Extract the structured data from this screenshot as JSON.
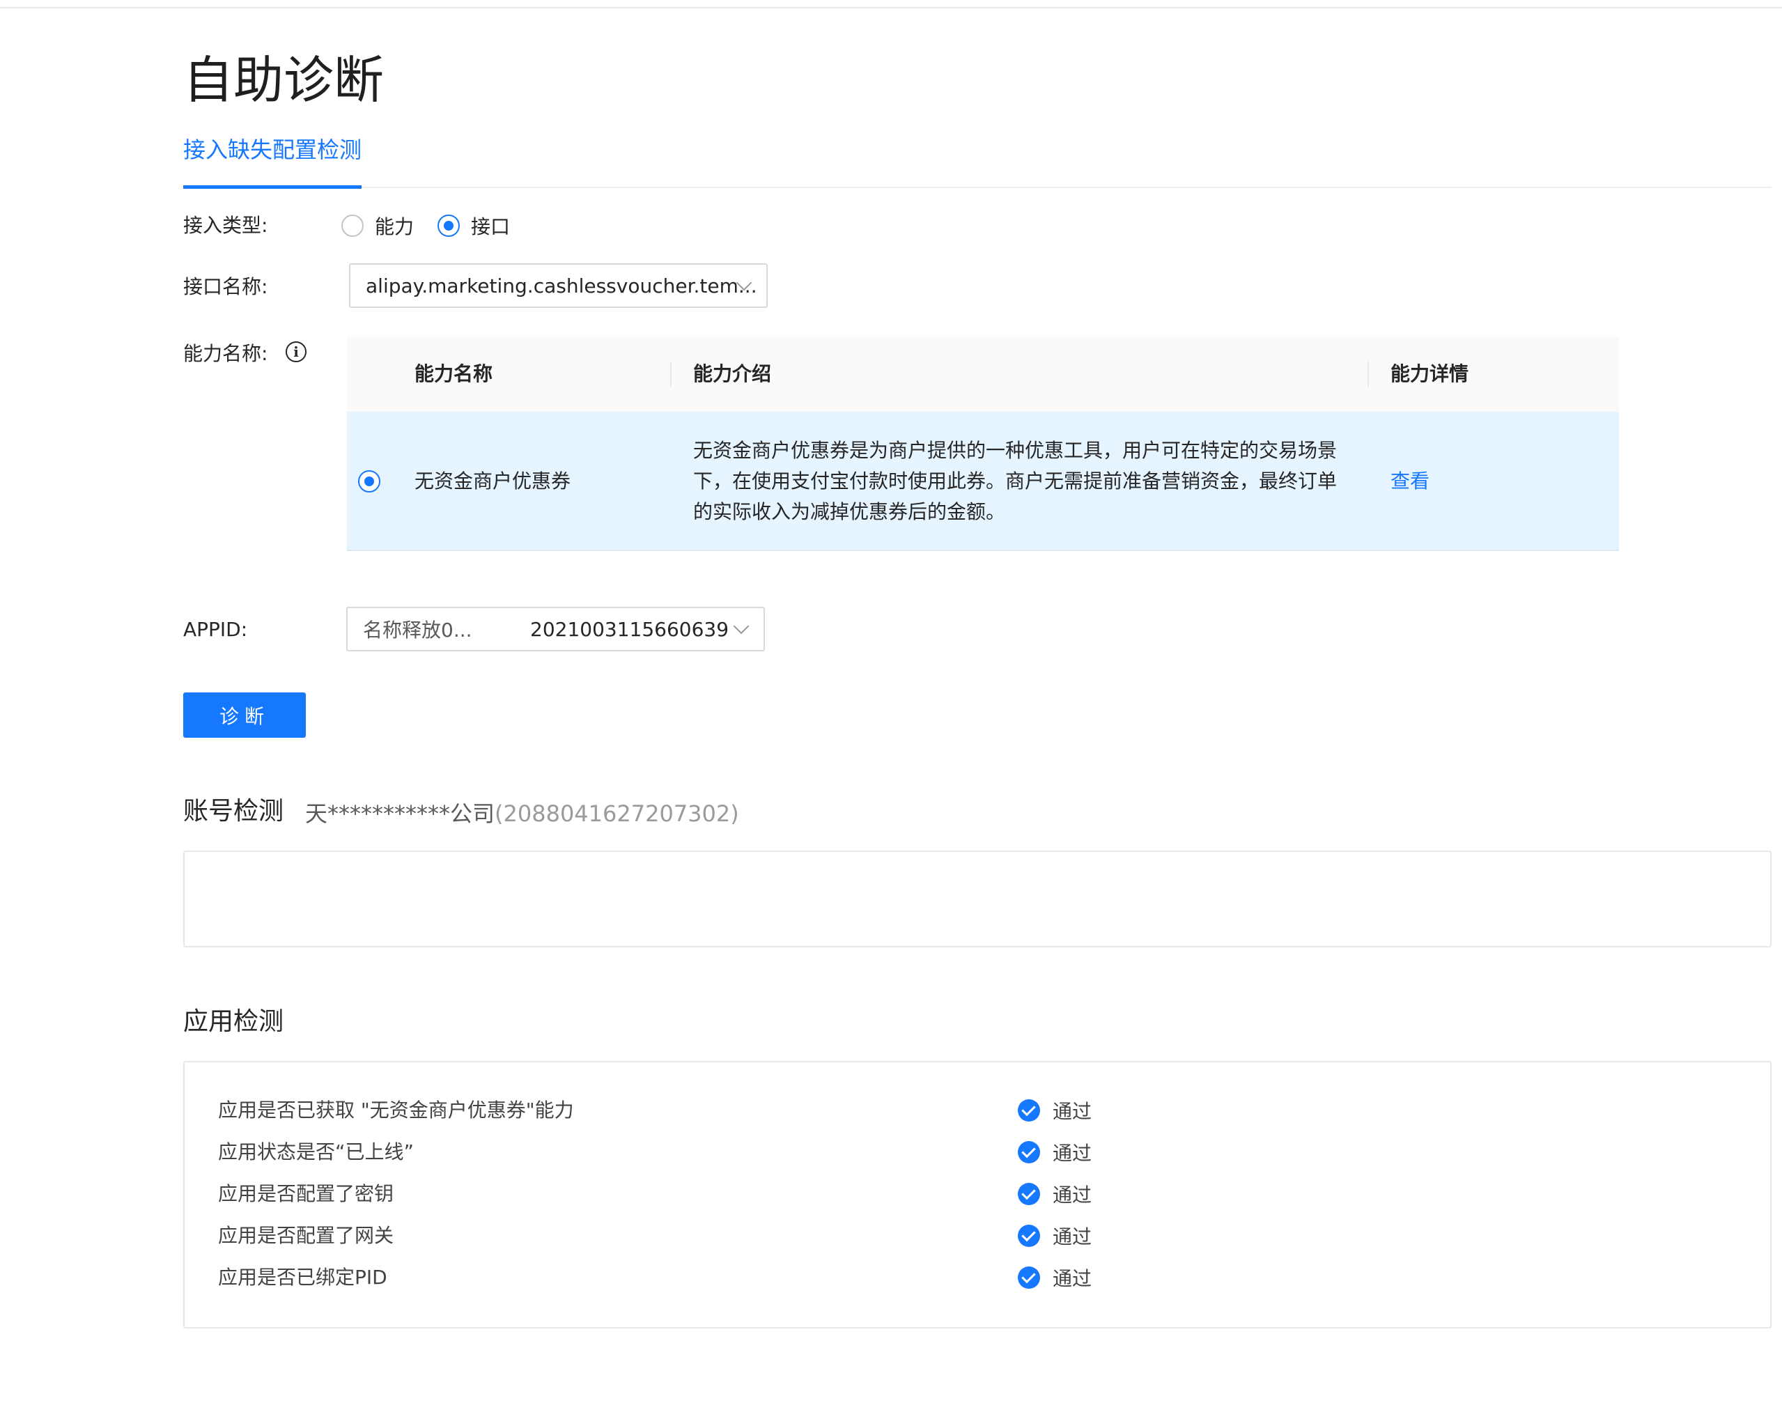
{
  "page": {
    "title": "自助诊断"
  },
  "tabs": [
    {
      "label": "接入缺失配置检测",
      "active": true
    }
  ],
  "form": {
    "access_type": {
      "label": "接入类型:",
      "options": [
        {
          "label": "能力",
          "checked": false
        },
        {
          "label": "接口",
          "checked": true
        }
      ]
    },
    "api_name": {
      "label": "接口名称:",
      "value": "alipay.marketing.cashlessvoucher.tem..."
    },
    "ability_name": {
      "label": "能力名称:",
      "info_icon": "info-icon"
    },
    "appid": {
      "label": "APPID:",
      "name": "名称释放0...",
      "id": "2021003115660639"
    }
  },
  "ability_table": {
    "headers": {
      "name": "能力名称",
      "intro": "能力介绍",
      "detail": "能力详情"
    },
    "rows": [
      {
        "selected": true,
        "name": "无资金商户优惠券",
        "intro_lines": [
          "无资金商户优惠券是为商户提供的一种优惠工具，用户可在特定的交易场景",
          "下，在使用支付宝付款时使用此券。商户无需提前准备营销资金，最终订单",
          "的实际收入为减掉优惠券后的金额。"
        ],
        "detail_link": "查看"
      }
    ]
  },
  "diagnose_button": {
    "label": "诊断"
  },
  "account_check": {
    "title": "账号检测",
    "account_name": "天***********公司",
    "account_pid": "(2088041627207302)"
  },
  "app_check": {
    "title": "应用检测",
    "items": [
      {
        "label": "应用是否已获取 \"无资金商户优惠券\"能力",
        "status": "通过"
      },
      {
        "label": "应用状态是否“已上线”",
        "status": "通过"
      },
      {
        "label": "应用是否配置了密钥",
        "status": "通过"
      },
      {
        "label": "应用是否配置了网关",
        "status": "通过"
      },
      {
        "label": "应用是否已绑定PID",
        "status": "通过"
      }
    ]
  },
  "colors": {
    "accent": "#1677ff",
    "row_highlight": "#e6f4ff",
    "header_bg": "#fafafa"
  }
}
